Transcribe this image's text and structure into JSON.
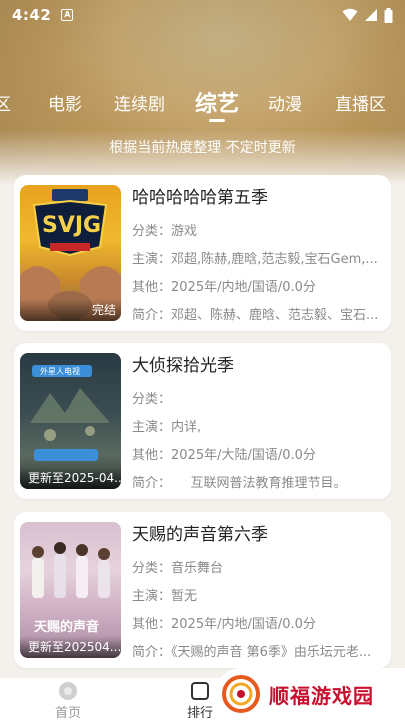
{
  "status_bar": {
    "time": "4:42",
    "notification_icon": "A"
  },
  "tabs": [
    {
      "label": "区"
    },
    {
      "label": "电影"
    },
    {
      "label": "连续剧"
    },
    {
      "label": "综艺",
      "active": true
    },
    {
      "label": "动漫"
    },
    {
      "label": "直播区"
    }
  ],
  "subtitle": "根据当前热度整理 不定时更新",
  "labels": {
    "category": "分类：",
    "cast": "主演：",
    "other": "其他：",
    "intro": "简介："
  },
  "items": [
    {
      "title": "哈哈哈哈哈第五季",
      "category": "游戏",
      "cast": "邓超,陈赫,鹿晗,范志毅,宝石Gem,...",
      "other": "2025年/内地/国语/0.0分",
      "intro": "邓超、陈赫、鹿晗、范志毅、宝石...",
      "badge": "完结",
      "poster_text": "SVJG"
    },
    {
      "title": "大侦探拾光季",
      "category": "",
      "cast": "内详,",
      "other": "2025年/大陆/国语/0.0分",
      "intro": "　　互联网普法教育推理节目。",
      "badge": "更新至2025-04...",
      "poster_text": "外星人电视"
    },
    {
      "title": "天赐的声音第六季",
      "category": "音乐舞台",
      "cast": "暂无",
      "other": "2025年/内地/国语/0.0分",
      "intro": "《天赐的声音 第6季》由乐坛元老...",
      "badge": "更新至202504...",
      "poster_text": "天赐的声音"
    }
  ],
  "nav": {
    "home": "首页",
    "rank": "排行"
  },
  "watermark": "顺福游戏园",
  "colors": {
    "accent": "#c8a870",
    "watermark": "#c8102e"
  }
}
